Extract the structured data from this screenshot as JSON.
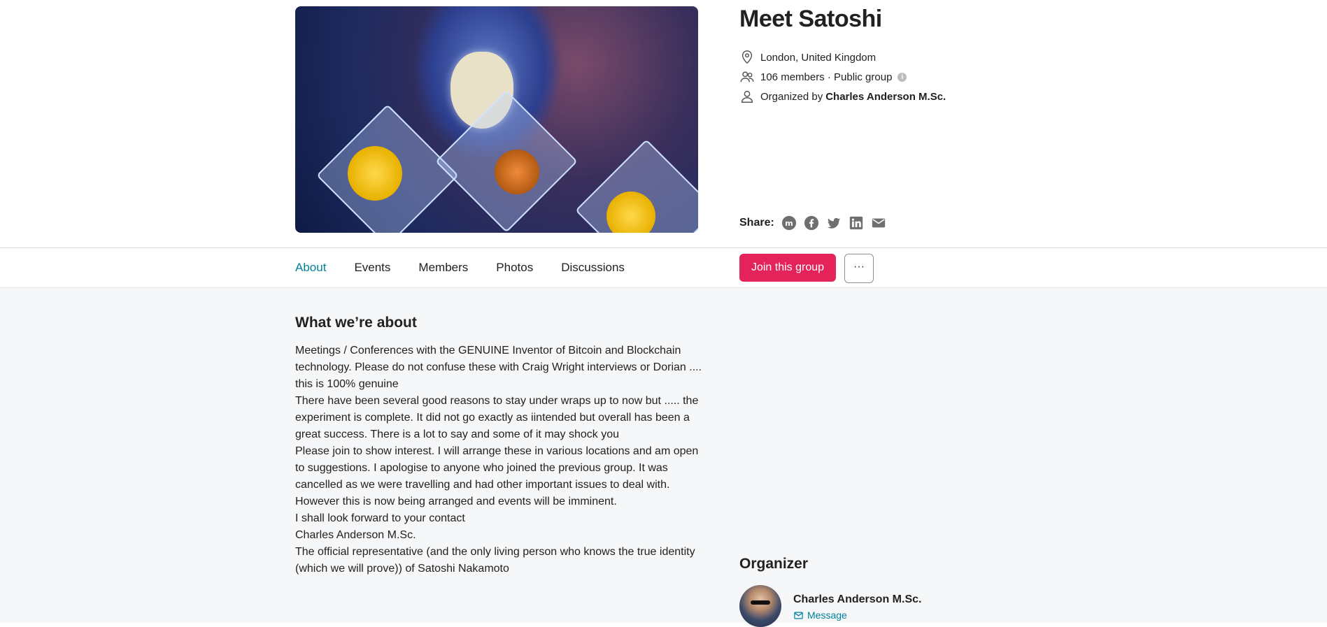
{
  "group": {
    "title": "Meet Satoshi",
    "location": "London, United Kingdom",
    "members_line": "106 members · Public group",
    "organized_prefix": "Organized by",
    "organizer_name": "Charles Anderson M.Sc."
  },
  "share": {
    "label": "Share:",
    "icons": [
      "meetup-icon",
      "facebook-icon",
      "twitter-icon",
      "linkedin-icon",
      "email-icon"
    ]
  },
  "tabs": [
    {
      "label": "About",
      "active": true
    },
    {
      "label": "Events"
    },
    {
      "label": "Members"
    },
    {
      "label": "Photos"
    },
    {
      "label": "Discussions"
    }
  ],
  "actions": {
    "join_label": "Join this group",
    "more_label": "···"
  },
  "about": {
    "heading": "What we’re about",
    "paragraphs": [
      "Meetings / Conferences with the GENUINE Inventor of Bitcoin and Blockchain technology. Please do not confuse these with Craig Wright interviews or Dorian .... this is 100% genuine",
      "There have been several good reasons to stay under wraps up to now but ..... the experiment is complete. It did not go exactly as iintended but overall has been a great success. There is a lot to say and some of it may shock you",
      "Please join to show interest. I will arrange these in various locations and am open to suggestions. I apologise to anyone who joined the previous group. It was cancelled as we were travelling and had other important issues to deal with. However this is now being arranged and events will be imminent.",
      "I shall look forward to your contact",
      "Charles Anderson M.Sc.",
      "The official representative (and the only living person who knows the true identity (which we will prove)) of Satoshi Nakamoto"
    ]
  },
  "organizer": {
    "heading": "Organizer",
    "name": "Charles Anderson M.Sc.",
    "message_label": "Message"
  },
  "colors": {
    "accent_teal": "#00829b",
    "join_red": "#e32359",
    "content_bg": "#f6f7f8"
  }
}
